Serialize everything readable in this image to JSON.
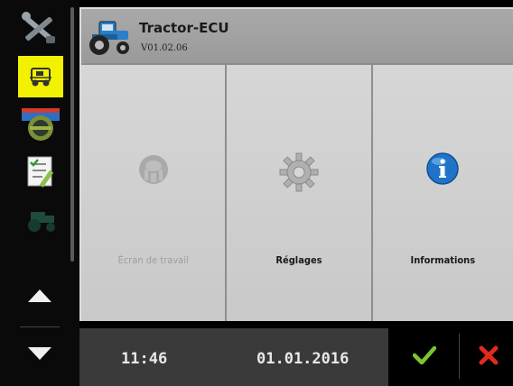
{
  "header": {
    "title": "Tractor-ECU",
    "version": "V01.02.06",
    "icon": "tractor-icon"
  },
  "sidebar": {
    "items": [
      {
        "name": "tools",
        "icon": "wrench-screwdriver-icon",
        "selected": false
      },
      {
        "name": "tractor-ecu",
        "icon": "ecu-tractor-icon",
        "selected": true
      },
      {
        "name": "guidance",
        "icon": "steering-wheel-icon",
        "selected": false
      },
      {
        "name": "task",
        "icon": "task-list-icon",
        "selected": false
      },
      {
        "name": "tractor",
        "icon": "tractor-dark-icon",
        "selected": false
      }
    ],
    "scroll_up_icon": "arrow-up-icon",
    "scroll_down_icon": "arrow-down-icon"
  },
  "tiles": [
    {
      "label": "Écran de travail",
      "icon": "work-screen-icon",
      "enabled": false
    },
    {
      "label": "Réglages",
      "icon": "gear-icon",
      "enabled": true
    },
    {
      "label": "Informations",
      "icon": "info-icon",
      "enabled": true
    }
  ],
  "statusbar": {
    "time": "11:46",
    "date": "01.01.2016"
  },
  "actions": {
    "confirm_icon": "checkmark-icon",
    "cancel_icon": "cross-icon"
  },
  "colors": {
    "selected_highlight": "#f2f200",
    "confirm": "#7cc52e",
    "cancel": "#e02a1e",
    "info_blue": "#1f74c8"
  }
}
